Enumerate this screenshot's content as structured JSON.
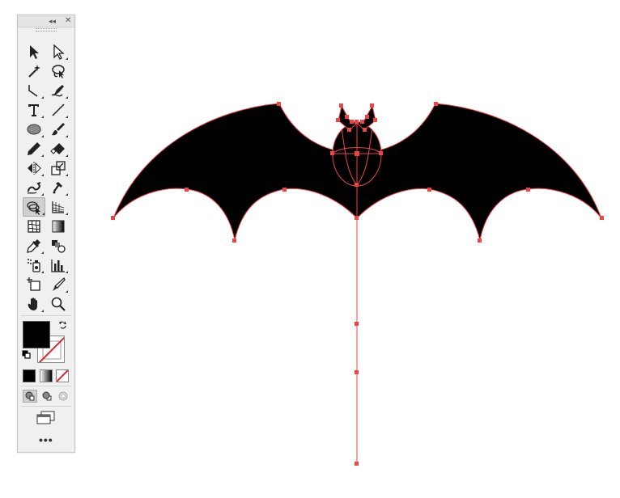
{
  "toolbar": {
    "collapse_glyph": "◂◂",
    "close_glyph": "✕",
    "more_glyph": "•••",
    "tools": [
      {
        "name": "selection-tool-icon"
      },
      {
        "name": "direct-selection-tool-icon"
      },
      {
        "name": "magic-wand-tool-icon"
      },
      {
        "name": "lasso-tool-icon"
      },
      {
        "name": "anchor-point-tool-icon"
      },
      {
        "name": "pen-tool-icon"
      },
      {
        "name": "type-tool-icon"
      },
      {
        "name": "line-segment-tool-icon"
      },
      {
        "name": "ellipse-tool-icon"
      },
      {
        "name": "paintbrush-tool-icon"
      },
      {
        "name": "pencil-tool-icon"
      },
      {
        "name": "eraser-tool-icon"
      },
      {
        "name": "reflect-tool-icon"
      },
      {
        "name": "scale-tool-icon"
      },
      {
        "name": "warp-tool-icon"
      },
      {
        "name": "puppet-warp-tool-icon"
      },
      {
        "name": "shape-builder-tool-icon",
        "active": true
      },
      {
        "name": "perspective-grid-tool-icon"
      },
      {
        "name": "mesh-tool-icon"
      },
      {
        "name": "gradient-tool-icon"
      },
      {
        "name": "eyedropper-tool-icon"
      },
      {
        "name": "blend-tool-icon"
      },
      {
        "name": "symbol-sprayer-tool-icon"
      },
      {
        "name": "column-graph-tool-icon"
      },
      {
        "name": "artboard-tool-icon"
      },
      {
        "name": "slice-tool-icon"
      },
      {
        "name": "hand-tool-icon"
      },
      {
        "name": "zoom-tool-icon"
      }
    ],
    "fill_color": "#000000",
    "stroke_color": "none",
    "accent_red": "#e8202a"
  },
  "artwork": {
    "fill": "#000000",
    "path_color": "#ee4444",
    "anchor_color": "#ee4444"
  }
}
